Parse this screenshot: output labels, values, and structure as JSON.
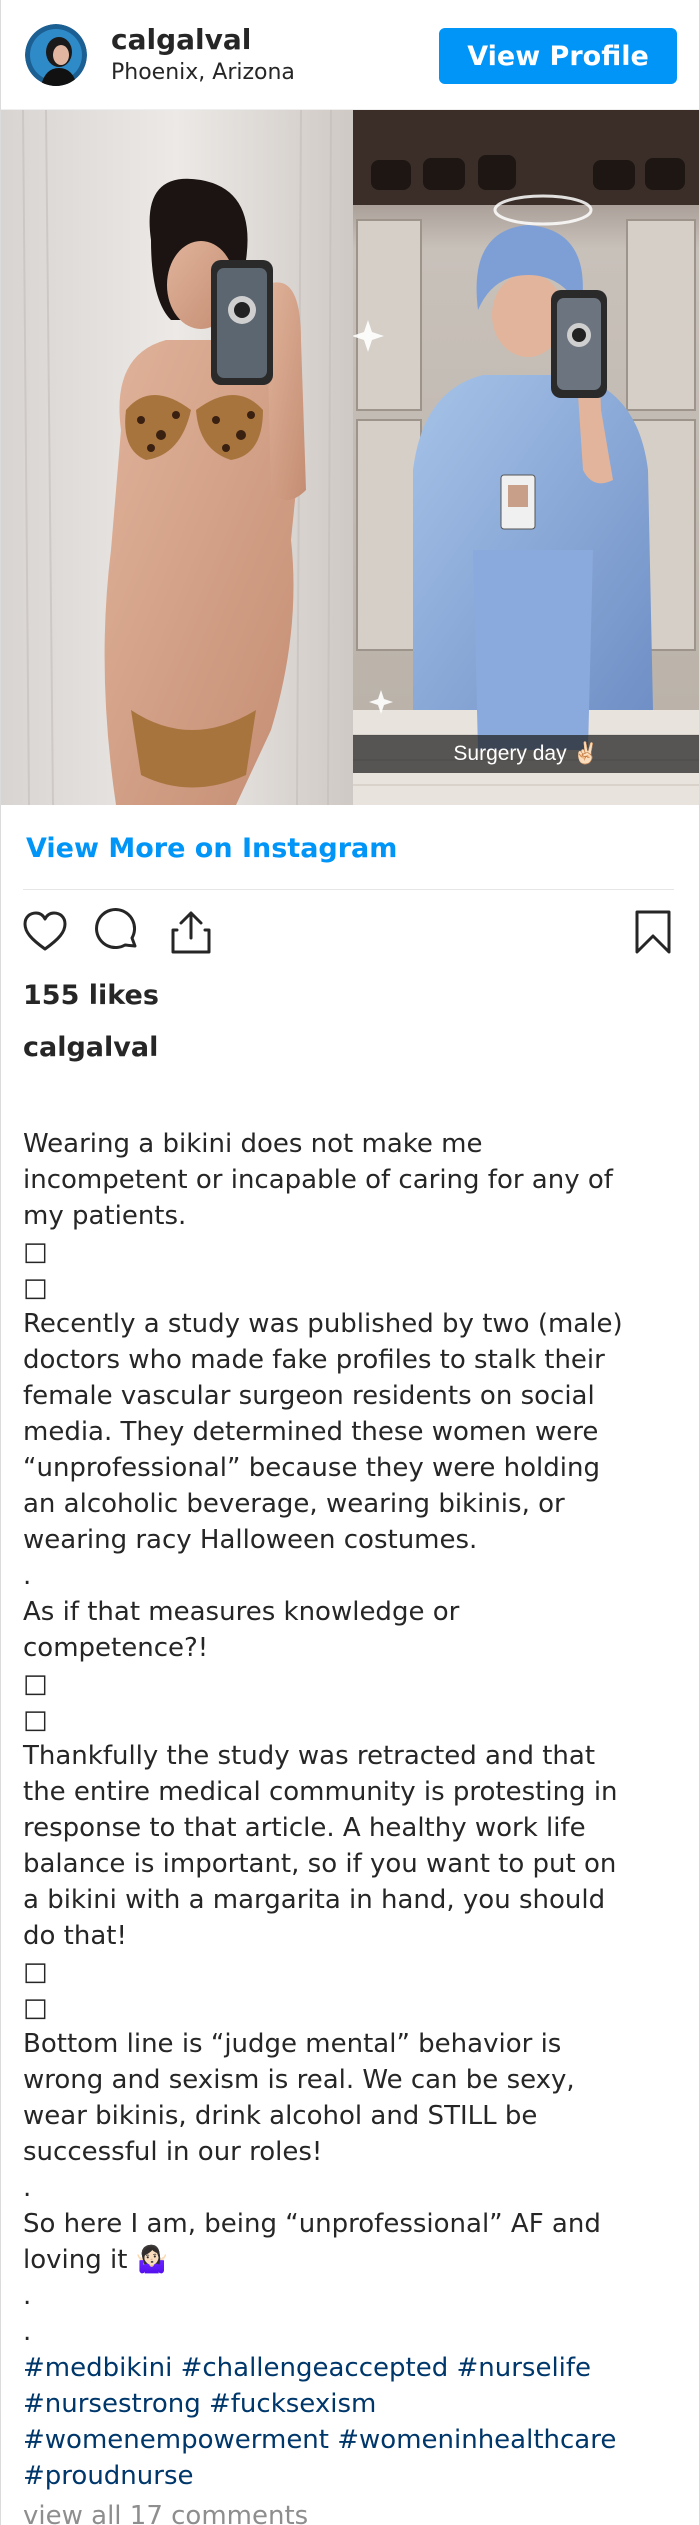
{
  "header": {
    "username": "calgalval",
    "location": "Phoenix, Arizona",
    "view_profile_label": "View Profile"
  },
  "media": {
    "left_photo": "woman in leopard-print bikini taking mirror selfie",
    "right_photo": "woman in blue surgical scrubs and cap taking mirror selfie",
    "overlay_caption": "Surgery day ✌🏻"
  },
  "view_more_label": "View More on Instagram",
  "actions": {
    "like_icon": "heart-icon",
    "comment_icon": "comment-icon",
    "share_icon": "share-icon",
    "save_icon": "bookmark-icon"
  },
  "likes": "155 likes",
  "caption": {
    "username": "calgalval",
    "lines": [
      "Wearing a bikini does not make me",
      "incompetent or incapable of caring for any of",
      "my patients.",
      "□",
      "□",
      "Recently a study was published by two (male)",
      "doctors who made fake profiles to stalk their",
      "female vascular surgeon residents on social",
      "media. They determined these women were",
      "“unprofessional” because they were holding",
      "an alcoholic beverage, wearing bikinis, or",
      "wearing racy Halloween costumes.",
      ".",
      "As if that measures knowledge or",
      "competence?!",
      "□",
      "□",
      "Thankfully the study was retracted and that",
      "the entire medical community is protesting in",
      "response to that article. A healthy work life",
      "balance is important, so if you want to put on",
      "a bikini with a margarita in hand, you should",
      "do that!",
      "□",
      "□",
      "Bottom line is “judge mental” behavior is",
      "wrong and sexism is real. We can be sexy,",
      "wear bikinis, drink alcohol and STILL be",
      "successful in our roles!",
      ".",
      "So here I am, being “unprofessional” AF and",
      "loving it 🤷🏻‍♀️",
      ".",
      "."
    ],
    "hashtag_lines": [
      "#medbikini #challengeaccepted #nurselife",
      "#nursestrong #fucksexism",
      "#womenempowerment #womeninhealthcare",
      "#proudnurse"
    ]
  },
  "comments_label": "view all 17 comments",
  "colors": {
    "accent": "#0095f6",
    "hashtag": "#00376b",
    "muted": "#8e8e8e",
    "text": "#262626"
  }
}
